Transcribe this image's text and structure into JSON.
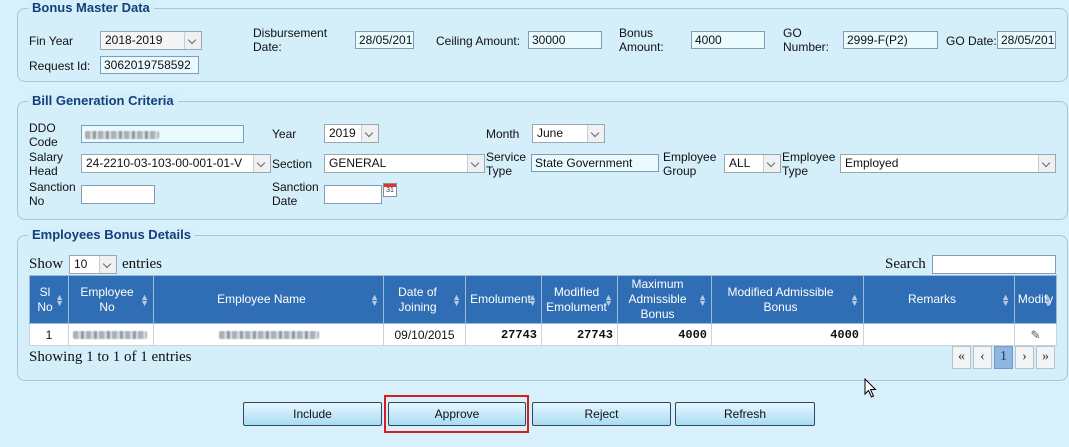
{
  "bonus_master": {
    "legend": "Bonus Master Data",
    "fin_year_label": "Fin Year",
    "fin_year_value": "2018-2019",
    "disbursement_label_1": "Disbursement",
    "disbursement_label_2": "Date:",
    "disbursement_value": "28/05/201",
    "ceiling_label": "Ceiling Amount:",
    "ceiling_value": "30000",
    "bonus_label_1": "Bonus",
    "bonus_label_2": "Amount:",
    "bonus_value": "4000",
    "go_number_label_1": "GO",
    "go_number_label_2": "Number:",
    "go_number_value": "2999-F(P2)",
    "go_date_label": "GO Date:",
    "go_date_value": "28/05/201",
    "request_id_label": "Request Id:",
    "request_id_value": "3062019758592"
  },
  "bill_criteria": {
    "legend": "Bill Generation Criteria",
    "ddo_label_1": "DDO",
    "ddo_label_2": "Code",
    "year_label": "Year",
    "year_value": "2019",
    "month_label": "Month",
    "month_value": "June",
    "salary_head_label_1": "Salary",
    "salary_head_label_2": "Head",
    "salary_head_value": "24-2210-03-103-00-001-01-V",
    "section_label": "Section",
    "section_value": "GENERAL",
    "service_type_label_1": "Service",
    "service_type_label_2": "Type",
    "service_type_value": "State Government",
    "employee_group_label_1": "Employee",
    "employee_group_label_2": "Group",
    "employee_group_value": "ALL",
    "employee_type_label_1": "Employee",
    "employee_type_label_2": "Type",
    "employee_type_value": "Employed",
    "sanction_no_label_1": "Sanction",
    "sanction_no_label_2": "No",
    "sanction_date_label_1": "Sanction",
    "sanction_date_label_2": "Date",
    "calendar_label": "31"
  },
  "employees": {
    "legend": "Employees Bonus Details",
    "show_label": "Show",
    "entries_value": "10",
    "entries_label": "entries",
    "search_label": "Search",
    "columns": {
      "sl_no": "Sl No",
      "employee_no": "Employee No",
      "employee_name": "Employee Name",
      "date_of_joining": "Date of Joining",
      "emolument": "Emolument",
      "modified_emolument": "Modified Emolument",
      "max_bonus": "Maximum Admissible Bonus",
      "modified_bonus": "Modified Admissible Bonus",
      "remarks": "Remarks",
      "modify": "Modify"
    },
    "rows": [
      {
        "sl_no": "1",
        "date_of_joining": "09/10/2015",
        "emolument": "27743",
        "modified_emolument": "27743",
        "max_bonus": "4000",
        "modified_bonus": "4000",
        "remarks": ""
      }
    ],
    "info": "Showing 1 to 1 of 1 entries",
    "pagination": {
      "first": "«",
      "prev": "‹",
      "current": "1",
      "next": "›",
      "last": "»"
    }
  },
  "actions": {
    "include": "Include",
    "approve": "Approve",
    "reject": "Reject",
    "refresh": "Refresh"
  },
  "icons": {
    "dropdown": "chevron-down-icon",
    "calendar": "calendar-icon",
    "edit": "pencil-icon",
    "sort": "sort-icon",
    "cursor": "mouse-pointer-icon"
  },
  "colors": {
    "background": "#d7f0fb",
    "legend_text": "#12407a",
    "table_header": "#2f6db4",
    "highlight": "#d21f1f"
  }
}
